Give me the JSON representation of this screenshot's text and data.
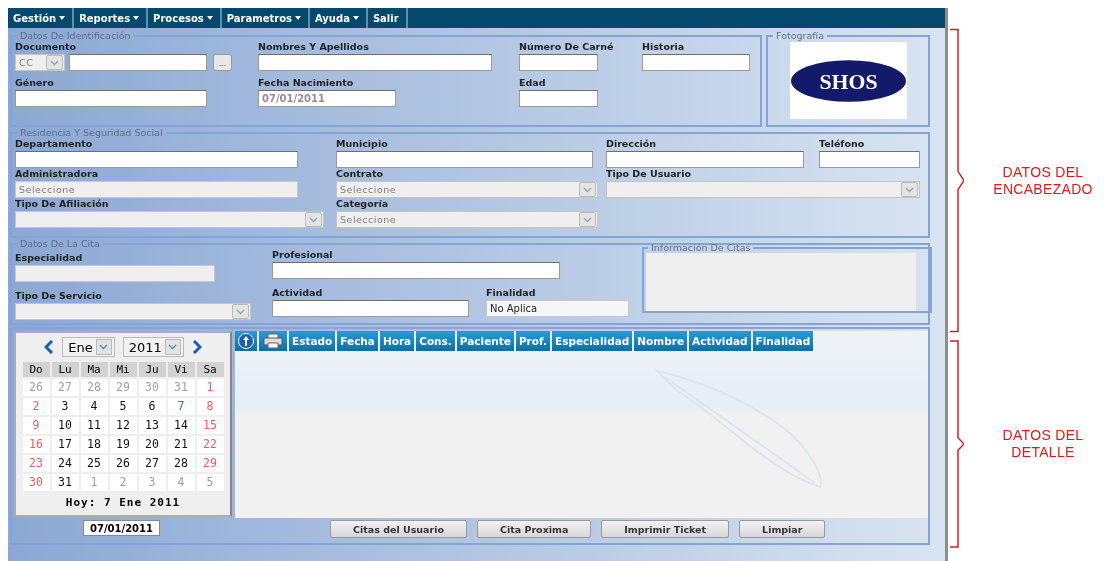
{
  "menu": [
    {
      "label": "Gestión",
      "has_dropdown": true
    },
    {
      "label": "Reportes",
      "has_dropdown": true
    },
    {
      "label": "Procesos",
      "has_dropdown": true
    },
    {
      "label": "Parametros",
      "has_dropdown": true
    },
    {
      "label": "Ayuda",
      "has_dropdown": true
    },
    {
      "label": "Salir",
      "has_dropdown": false
    }
  ],
  "identificacion": {
    "legend": "Datos De Identificación",
    "fields": [
      {
        "label": "Documento",
        "kind": "document",
        "type": "CC",
        "button": "..."
      },
      {
        "label": "Nombres Y Apellidos",
        "kind": "input"
      },
      {
        "label": "Número De Carné",
        "kind": "input"
      },
      {
        "label": "Historia",
        "kind": "input"
      },
      {
        "label": "Género",
        "kind": "input"
      },
      {
        "label": "Fecha Nacimiento",
        "kind": "input",
        "value": "07/01/2011",
        "disabled": true
      },
      {
        "label": "Edad",
        "kind": "input"
      }
    ]
  },
  "fotografia": {
    "legend": "Fotografía",
    "logo_text": "SHOS"
  },
  "residencia": {
    "legend": "Residencia Y Seguridad Social",
    "fields": [
      {
        "label": "Departamento",
        "kind": "input"
      },
      {
        "label": "Municipio",
        "kind": "input"
      },
      {
        "label": "Dirección",
        "kind": "input"
      },
      {
        "label": "Teléfono",
        "kind": "input"
      },
      {
        "label": "Administradora",
        "kind": "readonly",
        "placeholder": "Seleccione"
      },
      {
        "label": "Contrato",
        "kind": "select",
        "placeholder": "Seleccione"
      },
      {
        "label": "Tipo De Usuario",
        "kind": "select"
      },
      {
        "label": "Tipo De Afiliación",
        "kind": "select"
      },
      {
        "label": "Categoría",
        "kind": "select",
        "placeholder": "Seleccione"
      }
    ]
  },
  "cita": {
    "legend": "Datos De La Cita",
    "fields": [
      {
        "label": "Especialidad",
        "kind": "readonly"
      },
      {
        "label": "Profesional",
        "kind": "input"
      },
      {
        "label": "Tipo De Servicio",
        "kind": "select"
      },
      {
        "label": "Actividad",
        "kind": "input"
      },
      {
        "label": "Finalidad",
        "kind": "readonly",
        "value": "No Aplica"
      }
    ],
    "info_legend": "Información De Citas"
  },
  "calendar": {
    "month": "Ene",
    "year": "2011",
    "weekdays": [
      "Do",
      "Lu",
      "Ma",
      "Mi",
      "Ju",
      "Vi",
      "Sa"
    ],
    "weeks": [
      [
        {
          "day": "26",
          "kind": "other"
        },
        {
          "day": "27",
          "kind": "other"
        },
        {
          "day": "28",
          "kind": "other"
        },
        {
          "day": "29",
          "kind": "other"
        },
        {
          "day": "30",
          "kind": "other"
        },
        {
          "day": "31",
          "kind": "other"
        },
        {
          "day": "1",
          "kind": "weekend"
        }
      ],
      [
        {
          "day": "2",
          "kind": "weekend"
        },
        {
          "day": "3",
          "kind": "normal"
        },
        {
          "day": "4",
          "kind": "normal"
        },
        {
          "day": "5",
          "kind": "normal"
        },
        {
          "day": "6",
          "kind": "normal"
        },
        {
          "day": "7",
          "kind": "today"
        },
        {
          "day": "8",
          "kind": "weekend"
        }
      ],
      [
        {
          "day": "9",
          "kind": "weekend"
        },
        {
          "day": "10",
          "kind": "normal"
        },
        {
          "day": "11",
          "kind": "normal"
        },
        {
          "day": "12",
          "kind": "normal"
        },
        {
          "day": "13",
          "kind": "normal"
        },
        {
          "day": "14",
          "kind": "normal"
        },
        {
          "day": "15",
          "kind": "weekend"
        }
      ],
      [
        {
          "day": "16",
          "kind": "weekend"
        },
        {
          "day": "17",
          "kind": "normal"
        },
        {
          "day": "18",
          "kind": "normal"
        },
        {
          "day": "19",
          "kind": "normal"
        },
        {
          "day": "20",
          "kind": "normal"
        },
        {
          "day": "21",
          "kind": "normal"
        },
        {
          "day": "22",
          "kind": "weekend"
        }
      ],
      [
        {
          "day": "23",
          "kind": "weekend"
        },
        {
          "day": "24",
          "kind": "normal"
        },
        {
          "day": "25",
          "kind": "normal"
        },
        {
          "day": "26",
          "kind": "normal"
        },
        {
          "day": "27",
          "kind": "normal"
        },
        {
          "day": "28",
          "kind": "normal"
        },
        {
          "day": "29",
          "kind": "weekend"
        }
      ],
      [
        {
          "day": "30",
          "kind": "weekend"
        },
        {
          "day": "31",
          "kind": "normal"
        },
        {
          "day": "1",
          "kind": "other"
        },
        {
          "day": "2",
          "kind": "other"
        },
        {
          "day": "3",
          "kind": "other"
        },
        {
          "day": "4",
          "kind": "other"
        },
        {
          "day": "5",
          "kind": "other"
        }
      ]
    ],
    "today_text": "Hoy: 7 Ene 2011",
    "date_value": "07/01/2011"
  },
  "table": {
    "columns": [
      "Estado",
      "Fecha",
      "Hora",
      "Cons.",
      "Paciente",
      "Prof.",
      "Especialidad",
      "Nombre",
      "Actividad",
      "Finalidad"
    ]
  },
  "buttons": [
    "Citas del Usuario",
    "Cita Proxima",
    "Imprimir Ticket",
    "Limpiar"
  ],
  "annotations": [
    {
      "label": "DATOS DEL ENCABEZADO"
    },
    {
      "label": "DATOS DEL DETALLE"
    }
  ]
}
